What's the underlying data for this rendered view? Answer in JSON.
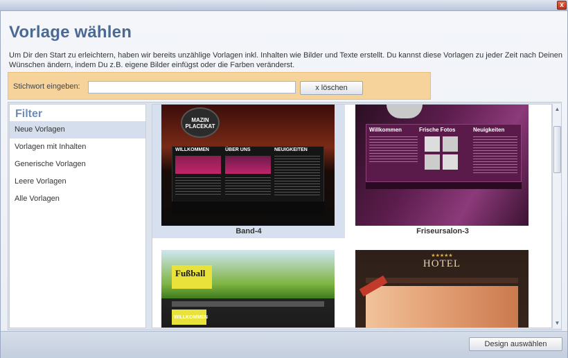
{
  "window": {
    "close_label": "x"
  },
  "dialog": {
    "title": "Vorlage wählen",
    "description": "Um Dir den Start zu erleichtern, haben wir bereits unzählige Vorlagen inkl. Inhalten wie Bilder und Texte erstellt. Du kannst diese Vorlagen zu jeder Zeit nach Deinen Wünschen ändern, indem Du z.B. eigene Bilder einfügst oder die Farben veränderst."
  },
  "search": {
    "label": "Stichwort eingeben:",
    "value": "",
    "placeholder": "",
    "clear_label": "x löschen"
  },
  "filter": {
    "title": "Filter",
    "items": [
      {
        "label": "Neue Vorlagen",
        "selected": true
      },
      {
        "label": "Vorlagen mit Inhalten",
        "selected": false
      },
      {
        "label": "Generische Vorlagen",
        "selected": false
      },
      {
        "label": "Leere Vorlagen",
        "selected": false
      },
      {
        "label": "Alle Vorlagen",
        "selected": false
      }
    ]
  },
  "templates": [
    {
      "name": "Band-4",
      "selected": true,
      "thumb": {
        "badge": "MAZIN PLACEKAT",
        "sections": [
          "WILLKOMMEN",
          "ÜBER UNS",
          "NEUIGKEITEN"
        ],
        "accent": "#c0246b"
      }
    },
    {
      "name": "Friseursalon-3",
      "selected": false,
      "thumb": {
        "sections": [
          "Willkommen",
          "Frische Fotos",
          "Neuigkeiten"
        ],
        "accent": "#7a1f63"
      }
    },
    {
      "name": "",
      "selected": false,
      "thumb": {
        "headline": "Fußball",
        "sections": [
          "WILLKOMMEN"
        ],
        "accent": "#e8e23a"
      }
    },
    {
      "name": "",
      "selected": false,
      "thumb": {
        "headline": "HOTEL",
        "stars": "★★★★★",
        "accent": "#a34a2a"
      }
    }
  ],
  "footer": {
    "select_label": "Design auswählen"
  }
}
